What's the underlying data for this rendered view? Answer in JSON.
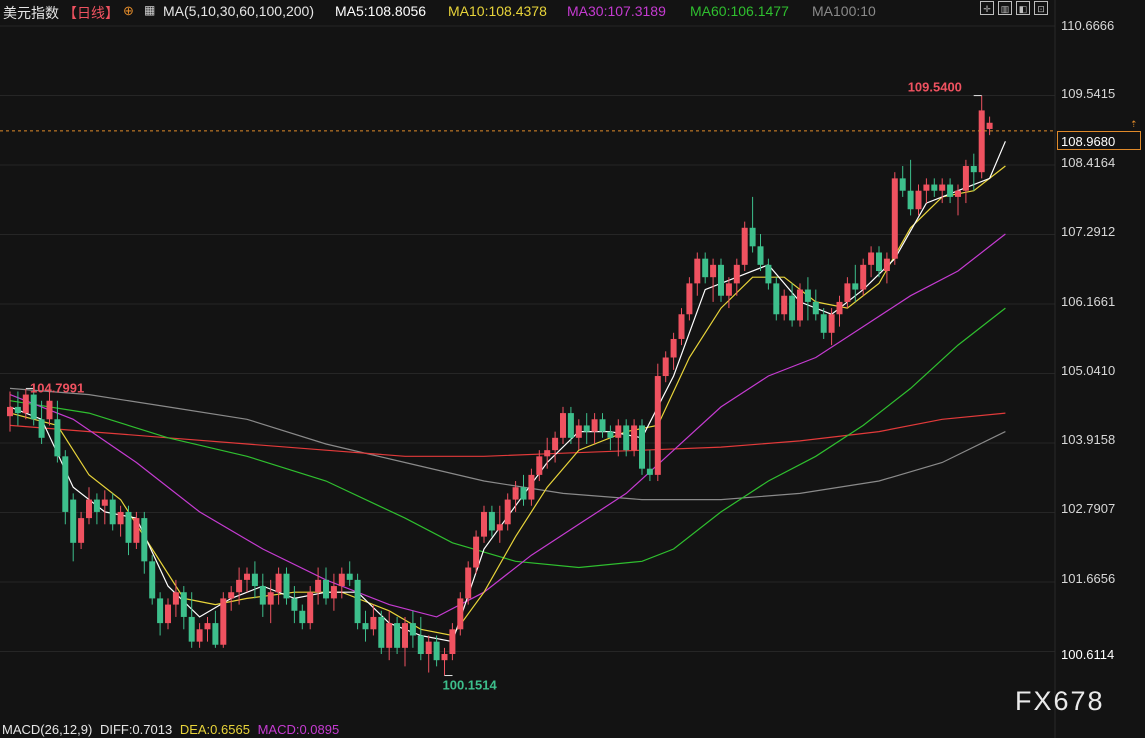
{
  "header": {
    "symbol": "美元指数",
    "period": "【日线】",
    "ma_params": "MA(5,10,30,60,100,200)",
    "ma5": "MA5:108.8056",
    "ma10": "MA10:108.4378",
    "ma30": "MA30:107.3189",
    "ma60": "MA60:106.1477",
    "ma100": "MA100:10"
  },
  "colors": {
    "up": "#ef5260",
    "down": "#3dbf8c",
    "ma5": "#ffffff",
    "ma10": "#e8d43a",
    "ma30": "#c53bd1",
    "ma60": "#2fbf2f",
    "ma100": "#8a8a8a",
    "ma200": "#e23a3a",
    "accent": "#e08a2a"
  },
  "yaxis": {
    "labels": [
      "110.6666",
      "109.5415",
      "108.4164",
      "107.2912",
      "106.1661",
      "105.0410",
      "103.9158",
      "102.7907",
      "101.6656"
    ],
    "current_price": "108.9680",
    "low_label": "100.6114"
  },
  "annotations": {
    "high": "109.5400",
    "low": "100.1514",
    "left_high": "104.7991"
  },
  "macd": {
    "params": "MACD(26,12,9)",
    "diff": "DIFF:0.7013",
    "dea": "DEA:0.6565",
    "macd": "MACD:0.0895"
  },
  "watermark": "FX678",
  "chart_data": {
    "type": "candlestick",
    "title": "美元指数【日线】",
    "ylim": [
      100.3,
      110.85
    ],
    "ohlc": [
      [
        104.35,
        104.75,
        104.1,
        104.5
      ],
      [
        104.5,
        104.75,
        104.2,
        104.4
      ],
      [
        104.4,
        104.79,
        104.3,
        104.7
      ],
      [
        104.7,
        104.78,
        104.2,
        104.3
      ],
      [
        104.3,
        104.6,
        103.9,
        104.0
      ],
      [
        104.3,
        104.8,
        104.2,
        104.6
      ],
      [
        104.3,
        104.6,
        103.6,
        103.7
      ],
      [
        103.7,
        103.8,
        102.6,
        102.8
      ],
      [
        103.0,
        103.1,
        102.0,
        102.3
      ],
      [
        102.3,
        102.8,
        102.2,
        102.7
      ],
      [
        102.7,
        103.2,
        102.6,
        103.0
      ],
      [
        103.0,
        103.1,
        102.6,
        102.8
      ],
      [
        102.9,
        103.15,
        102.6,
        103.0
      ],
      [
        103.0,
        103.1,
        102.5,
        102.6
      ],
      [
        102.6,
        102.9,
        102.4,
        102.8
      ],
      [
        102.8,
        102.9,
        102.1,
        102.3
      ],
      [
        102.3,
        102.8,
        102.2,
        102.7
      ],
      [
        102.7,
        102.8,
        101.8,
        102.0
      ],
      [
        102.0,
        102.1,
        101.3,
        101.4
      ],
      [
        101.4,
        101.5,
        100.8,
        101.0
      ],
      [
        101.0,
        101.4,
        100.9,
        101.3
      ],
      [
        101.3,
        101.7,
        101.1,
        101.5
      ],
      [
        101.5,
        101.6,
        100.9,
        101.1
      ],
      [
        101.1,
        101.5,
        100.6,
        100.7
      ],
      [
        100.7,
        101.0,
        100.6,
        100.9
      ],
      [
        100.9,
        101.1,
        100.7,
        101.0
      ],
      [
        101.0,
        101.2,
        100.6,
        100.65
      ],
      [
        100.65,
        101.5,
        100.6,
        101.4
      ],
      [
        101.4,
        101.6,
        101.2,
        101.5
      ],
      [
        101.5,
        101.9,
        101.3,
        101.7
      ],
      [
        101.7,
        101.9,
        101.5,
        101.8
      ],
      [
        101.8,
        102.0,
        101.4,
        101.6
      ],
      [
        101.6,
        101.8,
        101.1,
        101.3
      ],
      [
        101.3,
        101.7,
        101.0,
        101.5
      ],
      [
        101.5,
        101.9,
        101.3,
        101.8
      ],
      [
        101.8,
        101.9,
        101.3,
        101.4
      ],
      [
        101.4,
        101.6,
        101.0,
        101.2
      ],
      [
        101.2,
        101.3,
        100.9,
        101.0
      ],
      [
        101.0,
        101.6,
        100.9,
        101.5
      ],
      [
        101.5,
        101.9,
        101.3,
        101.7
      ],
      [
        101.7,
        101.9,
        101.3,
        101.4
      ],
      [
        101.4,
        101.8,
        101.2,
        101.6
      ],
      [
        101.6,
        101.9,
        101.4,
        101.8
      ],
      [
        101.8,
        102.0,
        101.6,
        101.7
      ],
      [
        101.7,
        101.8,
        100.9,
        101.0
      ],
      [
        101.0,
        101.2,
        100.7,
        100.9
      ],
      [
        100.9,
        101.3,
        100.8,
        101.1
      ],
      [
        101.1,
        101.2,
        100.5,
        100.6
      ],
      [
        100.6,
        101.2,
        100.4,
        101.0
      ],
      [
        101.0,
        101.1,
        100.5,
        100.6
      ],
      [
        100.6,
        101.1,
        100.3,
        101.0
      ],
      [
        101.0,
        101.2,
        100.6,
        100.8
      ],
      [
        100.8,
        101.1,
        100.4,
        100.5
      ],
      [
        100.5,
        100.8,
        100.2,
        100.7
      ],
      [
        100.7,
        100.8,
        100.3,
        100.4
      ],
      [
        100.4,
        100.6,
        100.15,
        100.5
      ],
      [
        100.5,
        101.0,
        100.4,
        100.9
      ],
      [
        100.9,
        101.5,
        100.8,
        101.4
      ],
      [
        101.4,
        102.0,
        101.3,
        101.9
      ],
      [
        101.9,
        102.5,
        101.8,
        102.4
      ],
      [
        102.4,
        102.9,
        102.3,
        102.8
      ],
      [
        102.8,
        102.9,
        102.4,
        102.5
      ],
      [
        102.5,
        102.9,
        102.3,
        102.6
      ],
      [
        102.6,
        103.1,
        102.5,
        103.0
      ],
      [
        103.0,
        103.3,
        102.8,
        103.2
      ],
      [
        103.2,
        103.4,
        102.9,
        103.0
      ],
      [
        103.0,
        103.5,
        102.9,
        103.4
      ],
      [
        103.4,
        103.8,
        103.3,
        103.7
      ],
      [
        103.7,
        104.0,
        103.5,
        103.8
      ],
      [
        103.8,
        104.1,
        103.6,
        104.0
      ],
      [
        104.0,
        104.5,
        103.9,
        104.4
      ],
      [
        104.4,
        104.5,
        103.9,
        104.0
      ],
      [
        104.0,
        104.3,
        103.8,
        104.2
      ],
      [
        104.2,
        104.4,
        103.9,
        104.1
      ],
      [
        104.1,
        104.4,
        103.9,
        104.3
      ],
      [
        104.3,
        104.4,
        104.0,
        104.1
      ],
      [
        104.1,
        104.2,
        103.8,
        104.0
      ],
      [
        104.0,
        104.3,
        103.7,
        104.2
      ],
      [
        104.2,
        104.3,
        103.7,
        103.8
      ],
      [
        103.8,
        104.3,
        103.7,
        104.2
      ],
      [
        104.2,
        104.3,
        103.4,
        103.5
      ],
      [
        103.5,
        103.8,
        103.3,
        103.4
      ],
      [
        103.4,
        105.2,
        103.3,
        105.0
      ],
      [
        105.0,
        105.4,
        104.9,
        105.3
      ],
      [
        105.3,
        105.7,
        105.1,
        105.6
      ],
      [
        105.6,
        106.1,
        105.5,
        106.0
      ],
      [
        106.0,
        106.6,
        105.9,
        106.5
      ],
      [
        106.5,
        107.0,
        106.3,
        106.9
      ],
      [
        106.9,
        107.0,
        106.5,
        106.6
      ],
      [
        106.6,
        106.9,
        106.2,
        106.8
      ],
      [
        106.8,
        106.9,
        106.2,
        106.3
      ],
      [
        106.3,
        106.6,
        106.1,
        106.5
      ],
      [
        106.5,
        106.9,
        106.3,
        106.8
      ],
      [
        106.8,
        107.5,
        106.7,
        107.4
      ],
      [
        107.4,
        107.9,
        107.0,
        107.1
      ],
      [
        107.1,
        107.3,
        106.7,
        106.8
      ],
      [
        106.8,
        106.9,
        106.4,
        106.5
      ],
      [
        106.5,
        106.6,
        105.9,
        106.0
      ],
      [
        106.0,
        106.4,
        105.9,
        106.3
      ],
      [
        106.3,
        106.5,
        105.8,
        105.9
      ],
      [
        105.9,
        106.5,
        105.8,
        106.4
      ],
      [
        106.4,
        106.6,
        105.9,
        106.2
      ],
      [
        106.2,
        106.4,
        105.9,
        106.0
      ],
      [
        106.0,
        106.1,
        105.6,
        105.7
      ],
      [
        105.7,
        106.1,
        105.5,
        106.0
      ],
      [
        106.0,
        106.3,
        105.8,
        106.2
      ],
      [
        106.2,
        106.6,
        106.1,
        106.5
      ],
      [
        106.5,
        106.8,
        106.2,
        106.4
      ],
      [
        106.4,
        106.9,
        106.3,
        106.8
      ],
      [
        106.8,
        107.1,
        106.6,
        107.0
      ],
      [
        107.0,
        107.1,
        106.6,
        106.7
      ],
      [
        106.7,
        107.0,
        106.5,
        106.9
      ],
      [
        106.9,
        108.3,
        106.8,
        108.2
      ],
      [
        108.2,
        108.4,
        107.9,
        108.0
      ],
      [
        108.0,
        108.5,
        107.6,
        107.7
      ],
      [
        107.7,
        108.1,
        107.6,
        108.0
      ],
      [
        108.0,
        108.2,
        107.8,
        108.1
      ],
      [
        108.1,
        108.2,
        107.9,
        108.0
      ],
      [
        108.0,
        108.2,
        107.8,
        108.1
      ],
      [
        108.1,
        108.2,
        107.8,
        107.9
      ],
      [
        107.9,
        108.1,
        107.6,
        108.0
      ],
      [
        108.0,
        108.5,
        107.8,
        108.4
      ],
      [
        108.4,
        108.6,
        108.0,
        108.3
      ],
      [
        108.3,
        109.54,
        108.2,
        109.3
      ],
      [
        109.0,
        109.2,
        108.9,
        109.1
      ]
    ],
    "series": [
      {
        "name": "MA5",
        "values": [
          [
            0,
            104.5
          ],
          [
            4,
            104.3
          ],
          [
            8,
            103.2
          ],
          [
            12,
            102.8
          ],
          [
            16,
            102.7
          ],
          [
            20,
            101.6
          ],
          [
            24,
            101.1
          ],
          [
            28,
            101.4
          ],
          [
            32,
            101.6
          ],
          [
            36,
            101.4
          ],
          [
            40,
            101.5
          ],
          [
            44,
            101.5
          ],
          [
            48,
            101.0
          ],
          [
            52,
            100.8
          ],
          [
            56,
            100.7
          ],
          [
            60,
            102.2
          ],
          [
            64,
            102.9
          ],
          [
            68,
            103.6
          ],
          [
            72,
            104.1
          ],
          [
            76,
            104.1
          ],
          [
            80,
            104.0
          ],
          [
            84,
            105.0
          ],
          [
            88,
            106.4
          ],
          [
            92,
            106.6
          ],
          [
            96,
            106.8
          ],
          [
            100,
            106.2
          ],
          [
            104,
            106.0
          ],
          [
            108,
            106.4
          ],
          [
            112,
            106.9
          ],
          [
            116,
            107.8
          ],
          [
            120,
            108.0
          ],
          [
            124,
            108.2
          ],
          [
            126,
            108.8
          ]
        ]
      },
      {
        "name": "MA10",
        "values": [
          [
            0,
            104.4
          ],
          [
            6,
            104.2
          ],
          [
            10,
            103.4
          ],
          [
            14,
            103.0
          ],
          [
            18,
            102.2
          ],
          [
            22,
            101.4
          ],
          [
            26,
            101.3
          ],
          [
            30,
            101.4
          ],
          [
            36,
            101.5
          ],
          [
            42,
            101.5
          ],
          [
            48,
            101.2
          ],
          [
            52,
            100.9
          ],
          [
            56,
            100.8
          ],
          [
            60,
            101.5
          ],
          [
            64,
            102.4
          ],
          [
            68,
            103.2
          ],
          [
            72,
            103.8
          ],
          [
            78,
            104.1
          ],
          [
            82,
            104.2
          ],
          [
            86,
            105.3
          ],
          [
            90,
            106.1
          ],
          [
            94,
            106.6
          ],
          [
            98,
            106.6
          ],
          [
            102,
            106.2
          ],
          [
            106,
            106.1
          ],
          [
            110,
            106.5
          ],
          [
            114,
            107.4
          ],
          [
            118,
            107.9
          ],
          [
            122,
            108.0
          ],
          [
            126,
            108.4
          ]
        ]
      },
      {
        "name": "MA30",
        "values": [
          [
            0,
            104.7
          ],
          [
            8,
            104.3
          ],
          [
            16,
            103.6
          ],
          [
            24,
            102.8
          ],
          [
            32,
            102.2
          ],
          [
            40,
            101.7
          ],
          [
            48,
            101.3
          ],
          [
            54,
            101.1
          ],
          [
            60,
            101.5
          ],
          [
            66,
            102.1
          ],
          [
            72,
            102.6
          ],
          [
            78,
            103.1
          ],
          [
            84,
            103.8
          ],
          [
            90,
            104.5
          ],
          [
            96,
            105.0
          ],
          [
            102,
            105.3
          ],
          [
            108,
            105.8
          ],
          [
            114,
            106.3
          ],
          [
            120,
            106.7
          ],
          [
            126,
            107.3
          ]
        ]
      },
      {
        "name": "MA60",
        "values": [
          [
            0,
            104.6
          ],
          [
            10,
            104.4
          ],
          [
            20,
            104.0
          ],
          [
            30,
            103.7
          ],
          [
            40,
            103.3
          ],
          [
            50,
            102.7
          ],
          [
            56,
            102.3
          ],
          [
            64,
            102.0
          ],
          [
            72,
            101.9
          ],
          [
            80,
            102.0
          ],
          [
            84,
            102.2
          ],
          [
            90,
            102.8
          ],
          [
            96,
            103.3
          ],
          [
            102,
            103.7
          ],
          [
            108,
            104.2
          ],
          [
            114,
            104.8
          ],
          [
            120,
            105.5
          ],
          [
            126,
            106.1
          ]
        ]
      },
      {
        "name": "MA100",
        "values": [
          [
            0,
            104.8
          ],
          [
            10,
            104.7
          ],
          [
            20,
            104.5
          ],
          [
            30,
            104.3
          ],
          [
            40,
            103.9
          ],
          [
            50,
            103.6
          ],
          [
            60,
            103.3
          ],
          [
            70,
            103.1
          ],
          [
            80,
            103.0
          ],
          [
            90,
            103.0
          ],
          [
            100,
            103.1
          ],
          [
            110,
            103.3
          ],
          [
            118,
            103.6
          ],
          [
            126,
            104.1
          ]
        ]
      },
      {
        "name": "MA200",
        "values": [
          [
            0,
            104.2
          ],
          [
            10,
            104.1
          ],
          [
            20,
            104.0
          ],
          [
            30,
            103.9
          ],
          [
            40,
            103.8
          ],
          [
            50,
            103.7
          ],
          [
            60,
            103.7
          ],
          [
            70,
            103.75
          ],
          [
            80,
            103.8
          ],
          [
            90,
            103.85
          ],
          [
            100,
            103.95
          ],
          [
            110,
            104.1
          ],
          [
            118,
            104.3
          ],
          [
            126,
            104.4
          ]
        ]
      }
    ]
  }
}
